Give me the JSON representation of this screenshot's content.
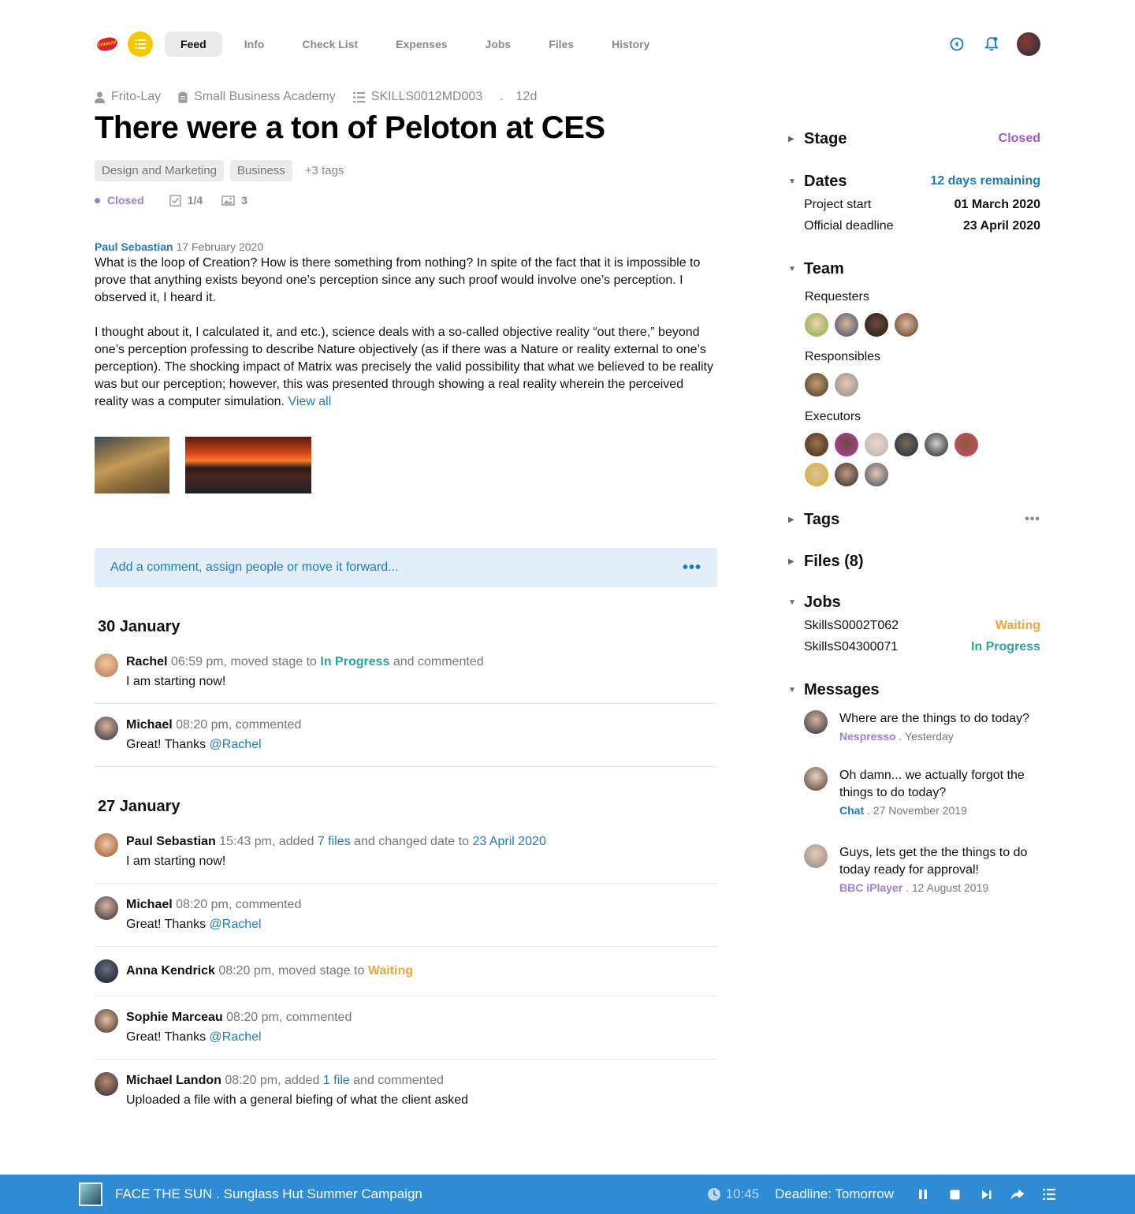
{
  "nav": {
    "logo_text": "FritoLay",
    "tabs": [
      "Feed",
      "Info",
      "Check List",
      "Expenses",
      "Jobs",
      "Files",
      "History"
    ],
    "active_tab": "Feed"
  },
  "meta": {
    "client": "Frito-Lay",
    "project": "Small Business Academy",
    "code": "SKILLS0012MD003",
    "separator": ".",
    "age": "12d"
  },
  "title": "There were a ton of Peloton at CES",
  "tags": [
    "Design and Marketing",
    "Business"
  ],
  "tags_more": "+3 tags",
  "status": {
    "stage": "Closed",
    "checklist": "1/4",
    "images": "3"
  },
  "post": {
    "author": "Paul Sebastian",
    "date": "17 February 2020",
    "para1": "What is the loop of Creation? How is there something from nothing? In spite of the fact that it is impossible to prove that anything exists beyond one’s perception since any such proof would involve one’s perception. I observed it, I heard it.",
    "para2": "I thought about it, I calculated it, and etc.), science deals with a so-called objective reality “out there,” beyond one’s perception professing to describe Nature objectively (as if there was a Nature or reality external to one’s perception). The shocking impact of Matrix was precisely the valid possibility that what we believed to be reality was but our perception; however, this was presented through showing a real reality wherein the perceived reality was a computer simulation.",
    "view_all": "View all"
  },
  "comment_placeholder": "Add a comment, assign people or move it forward...",
  "comment_more": "•••",
  "feed": {
    "day1": "30 January",
    "day2": "27 January",
    "a1": {
      "who": "Rachel",
      "time": "06:59 pm, moved stage to",
      "stage": "In Progress",
      "tail": "and commented",
      "text": "I am starting now!"
    },
    "a2": {
      "who": "Michael",
      "time": "08:20 pm, commented",
      "text": "Great! Thanks",
      "mention": "@Rachel"
    },
    "a3": {
      "who": "Paul Sebastian",
      "time": "15:43 pm, added",
      "files": "7 files",
      "mid": "and changed date to",
      "date": "23 April 2020",
      "text": "I am starting now!"
    },
    "a4": {
      "who": "Michael",
      "time": "08:20 pm, commented",
      "text": "Great! Thanks",
      "mention": "@Rachel"
    },
    "a5": {
      "who": "Anna Kendrick",
      "time": "08:20 pm, moved stage to",
      "stage": "Waiting"
    },
    "a6": {
      "who": "Sophie Marceau",
      "time": "08:20 pm, commented",
      "text": "Great! Thanks",
      "mention": "@Rachel"
    },
    "a7": {
      "who": "Michael Landon",
      "time": "08:20 pm, added",
      "files": "1 file",
      "tail": "and commented",
      "text": "Uploaded a file with a general biefing of what the client asked"
    }
  },
  "sidebar": {
    "stage_label": "Stage",
    "stage_value": "Closed",
    "dates_label": "Dates",
    "dates_remaining": "12 days remaining",
    "project_start_label": "Project start",
    "project_start": "01 March 2020",
    "deadline_label": "Official deadline",
    "deadline": "23 April 2020",
    "team_label": "Team",
    "requesters_label": "Requesters",
    "responsibles_label": "Responsibles",
    "executors_label": "Executors",
    "tags_label": "Tags",
    "tags_more": "•••",
    "files_label": "Files (8)",
    "jobs_label": "Jobs",
    "job1": "SkillsS0002T062",
    "job1_status": "Waiting",
    "job2": "SkillsS04300071",
    "job2_status": "In Progress",
    "messages_label": "Messages",
    "m1": {
      "text": "Where are the things to do today?",
      "src": "Nespresso",
      "when": ". Yesterday"
    },
    "m2": {
      "text": "Oh damn... we actually forgot the things to do today?",
      "src": "Chat",
      "when": ". 27 November 2019"
    },
    "m3": {
      "text": "Guys, lets get the the things to do today ready for approval!",
      "src": "BBC iPlayer",
      "when": ". 12 August 2019"
    }
  },
  "footer": {
    "title": "FACE THE SUN . Sunglass Hut Summer Campaign",
    "time": "10:45",
    "deadline": "Deadline: Tomorrow"
  },
  "colors": {
    "accent_blue": "#1a7cc4",
    "closed_purple": "#9b7fd6",
    "waiting_orange": "#f3a536",
    "progress_green": "#2aa598",
    "footer_blue": "#2f8bd4"
  }
}
